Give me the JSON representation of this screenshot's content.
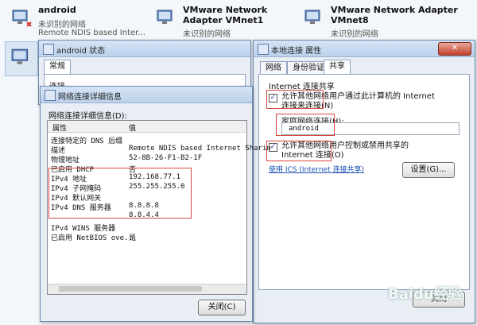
{
  "adapters": [
    {
      "name": "android",
      "status": "未识别的网络",
      "sub": "Remote NDIS based Inter..."
    },
    {
      "name": "VMware Network Adapter VMnet1",
      "status": "未识别的网络",
      "sub": ""
    },
    {
      "name": "VMware Network Adapter VMnet8",
      "status": "未识别的网络",
      "sub": ""
    }
  ],
  "status_window": {
    "title": "android 状态",
    "tab": "常规",
    "partial_label": "连接"
  },
  "details_window": {
    "title": "网络连接详细信息",
    "heading": "网络连接详细信息(D):",
    "col_property": "属性",
    "col_value": "值",
    "rows": [
      {
        "p": "连接特定的 DNS 后缀",
        "v": ""
      },
      {
        "p": "描述",
        "v": "Remote NDIS based Internet Sharin"
      },
      {
        "p": "物理地址",
        "v": "52-8B-26-F1-B2-1F"
      },
      {
        "p": "已启用 DHCP",
        "v": "否"
      },
      {
        "p": "IPv4 地址",
        "v": "192.168.77.1"
      },
      {
        "p": "IPv4 子网掩码",
        "v": "255.255.255.0"
      },
      {
        "p": "IPv4 默认网关",
        "v": ""
      },
      {
        "p": "IPv4 DNS 服务器",
        "v": "8.8.8.8"
      },
      {
        "p": "",
        "v": "8.8.4.4"
      },
      {
        "p": "IPv4 WINS 服务器",
        "v": ""
      },
      {
        "p": "已启用 NetBIOS ove...",
        "v": "是"
      }
    ],
    "close_button": "关闭(C)"
  },
  "properties_window": {
    "title": "本地连接 属性",
    "tabs": [
      "网络",
      "身份验证",
      "共享"
    ],
    "group_title": "Internet 连接共享",
    "allow_share_label": "允许其他网络用户通过此计算机的 Internet 连接来连接(N)",
    "home_network_label": "家庭网络连接(H):",
    "home_network_value": "android",
    "allow_control_label": "允许其他网络用户控制或禁用共享的 Internet 连接(O)",
    "ics_link": "使用 ICS (Internet 连接共享)",
    "settings_button": "设置(G)...",
    "close_tip": "关闭"
  },
  "watermark": "Baidu经验"
}
